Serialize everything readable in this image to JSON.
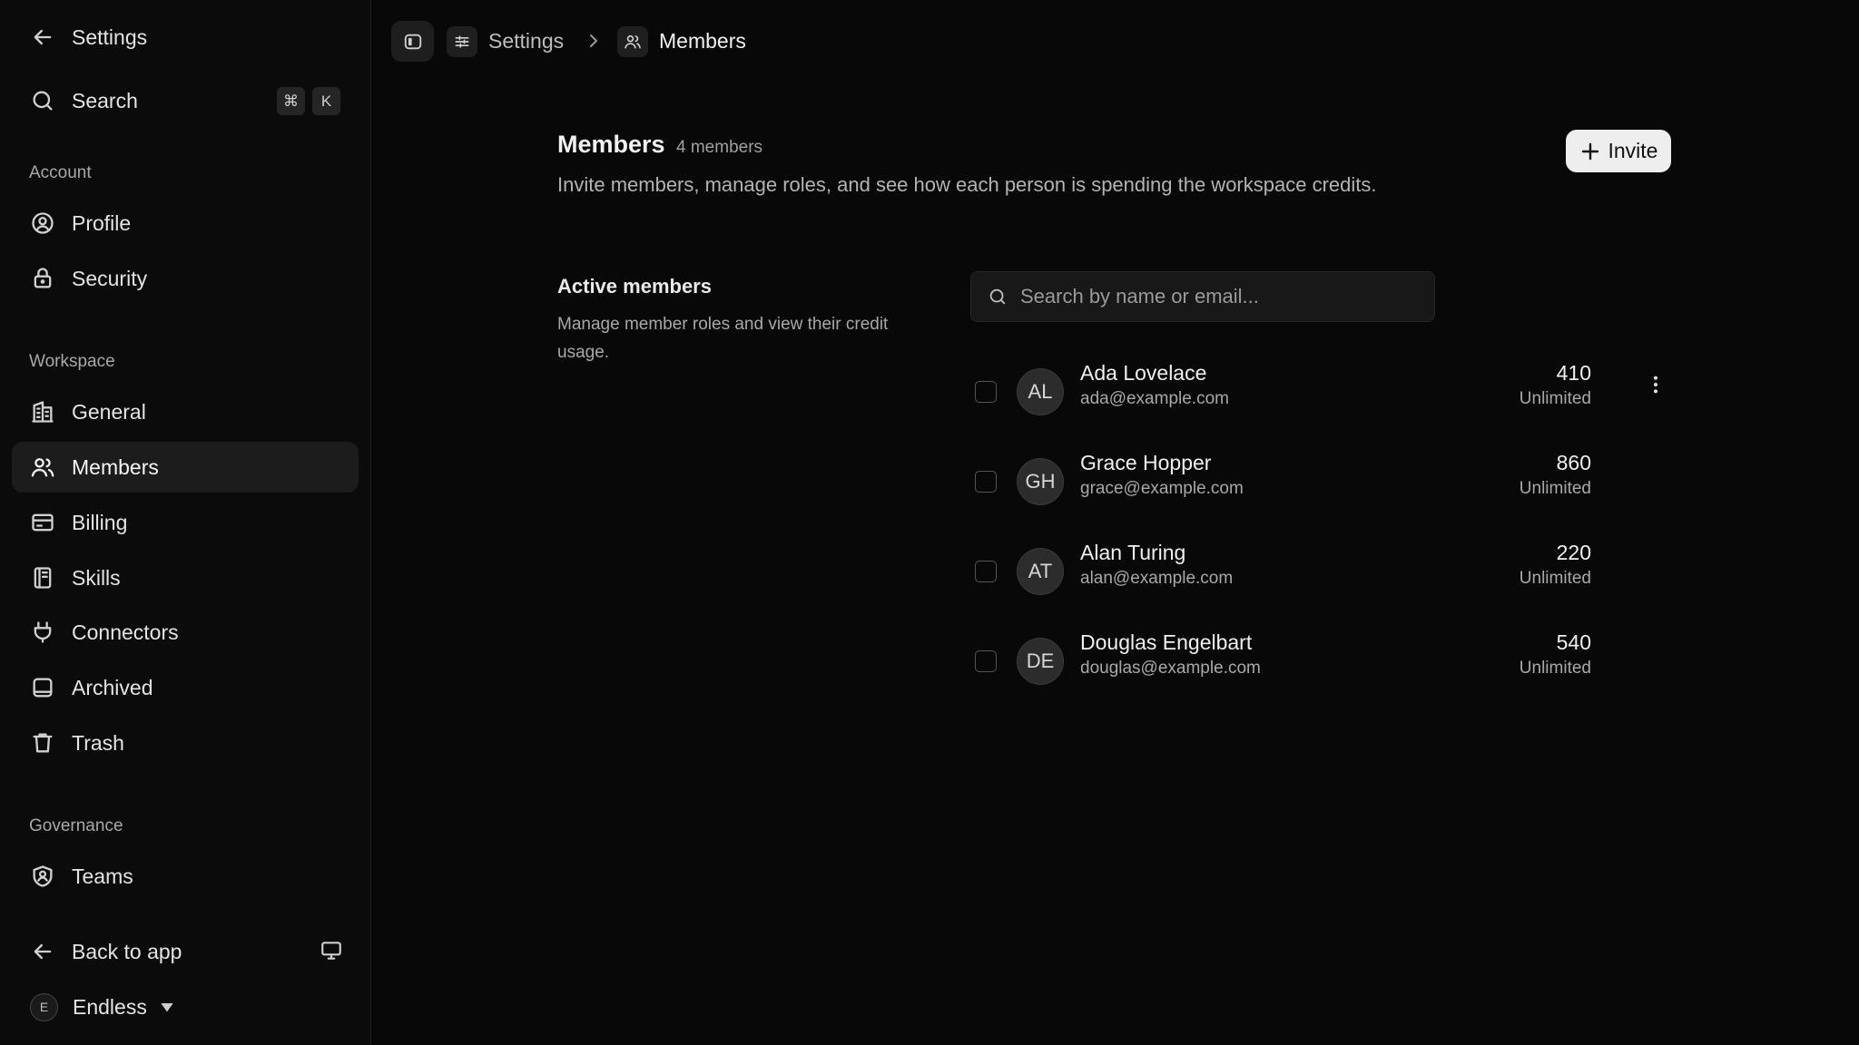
{
  "sidebar": {
    "back_label": "Settings",
    "search_label": "Search",
    "search_shortcut": [
      "⌘",
      "K"
    ],
    "sections": [
      {
        "label": "Account",
        "items": [
          {
            "label": "Profile",
            "icon": "user-circle-icon"
          },
          {
            "label": "Security",
            "icon": "lock-icon"
          }
        ]
      },
      {
        "label": "Workspace",
        "items": [
          {
            "label": "General",
            "icon": "building-icon"
          },
          {
            "label": "Members",
            "icon": "users-icon",
            "active": true
          },
          {
            "label": "Billing",
            "icon": "credit-card-icon"
          },
          {
            "label": "Skills",
            "icon": "book-icon"
          },
          {
            "label": "Connectors",
            "icon": "plug-icon"
          },
          {
            "label": "Archived",
            "icon": "archive-icon"
          },
          {
            "label": "Trash",
            "icon": "trash-icon"
          }
        ]
      },
      {
        "label": "Governance",
        "items": [
          {
            "label": "Teams",
            "icon": "shield-user-icon"
          }
        ]
      }
    ],
    "back_to_app": "Back to app",
    "workspace": {
      "initial": "E",
      "name": "Endless"
    }
  },
  "breadcrumb": {
    "parent": "Settings",
    "current": "Members"
  },
  "page": {
    "title": "Members",
    "member_count": "4 members",
    "description": "Invite members, manage roles, and see how each person is spending the workspace credits.",
    "invite_label": "Invite"
  },
  "active_members": {
    "title": "Active members",
    "description": "Manage member roles and view their credit usage.",
    "search_placeholder": "Search by name or email...",
    "members": [
      {
        "initials": "AL",
        "name": "Ada Lovelace",
        "email": "ada@example.com",
        "credits": "410",
        "limit": "Unlimited"
      },
      {
        "initials": "GH",
        "name": "Grace Hopper",
        "email": "grace@example.com",
        "credits": "860",
        "limit": "Unlimited"
      },
      {
        "initials": "AT",
        "name": "Alan Turing",
        "email": "alan@example.com",
        "credits": "220",
        "limit": "Unlimited"
      },
      {
        "initials": "DE",
        "name": "Douglas Engelbart",
        "email": "douglas@example.com",
        "credits": "540",
        "limit": "Unlimited"
      }
    ]
  },
  "colors": {
    "background": "#080808",
    "sidebar": "#0b0b0b",
    "active_item": "#1c1c1c",
    "invite_button": "#eeeeee"
  }
}
